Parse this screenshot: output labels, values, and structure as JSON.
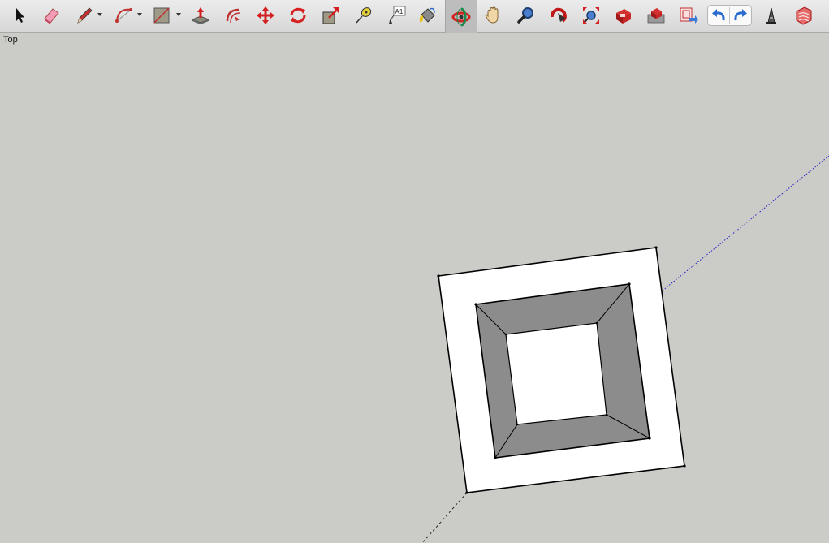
{
  "toolbar": {
    "tools": [
      {
        "name": "select-tool"
      },
      {
        "name": "eraser-tool"
      },
      {
        "name": "pencil-tool"
      },
      {
        "name": "arc-tool"
      },
      {
        "name": "rectangle-tool"
      },
      {
        "name": "push-pull-tool"
      },
      {
        "name": "offset-tool"
      },
      {
        "name": "move-tool"
      },
      {
        "name": "rotate-tool"
      },
      {
        "name": "scale-tool"
      },
      {
        "name": "tape-measure-tool"
      },
      {
        "name": "text-tool"
      },
      {
        "name": "paint-bucket-tool"
      },
      {
        "name": "orbit-tool",
        "active": true
      },
      {
        "name": "pan-tool"
      },
      {
        "name": "zoom-tool"
      },
      {
        "name": "zoom-window-tool"
      },
      {
        "name": "zoom-extents-tool"
      },
      {
        "name": "warehouse-tool"
      },
      {
        "name": "share-model-tool"
      },
      {
        "name": "extension-warehouse-tool"
      },
      {
        "name": "undo"
      },
      {
        "name": "redo"
      },
      {
        "name": "layout-tool"
      },
      {
        "name": "extension-manager-tool"
      }
    ],
    "text_tool_glyph": "A1"
  },
  "viewport": {
    "view_label": "Top",
    "background_color": "#cbcbc7"
  },
  "colors": {
    "face_white": "#ffffff",
    "face_gray": "#8c8c8c",
    "edge": "#000000",
    "axis_green": "#2a2a2a",
    "axis_blue": "#2222cc"
  }
}
